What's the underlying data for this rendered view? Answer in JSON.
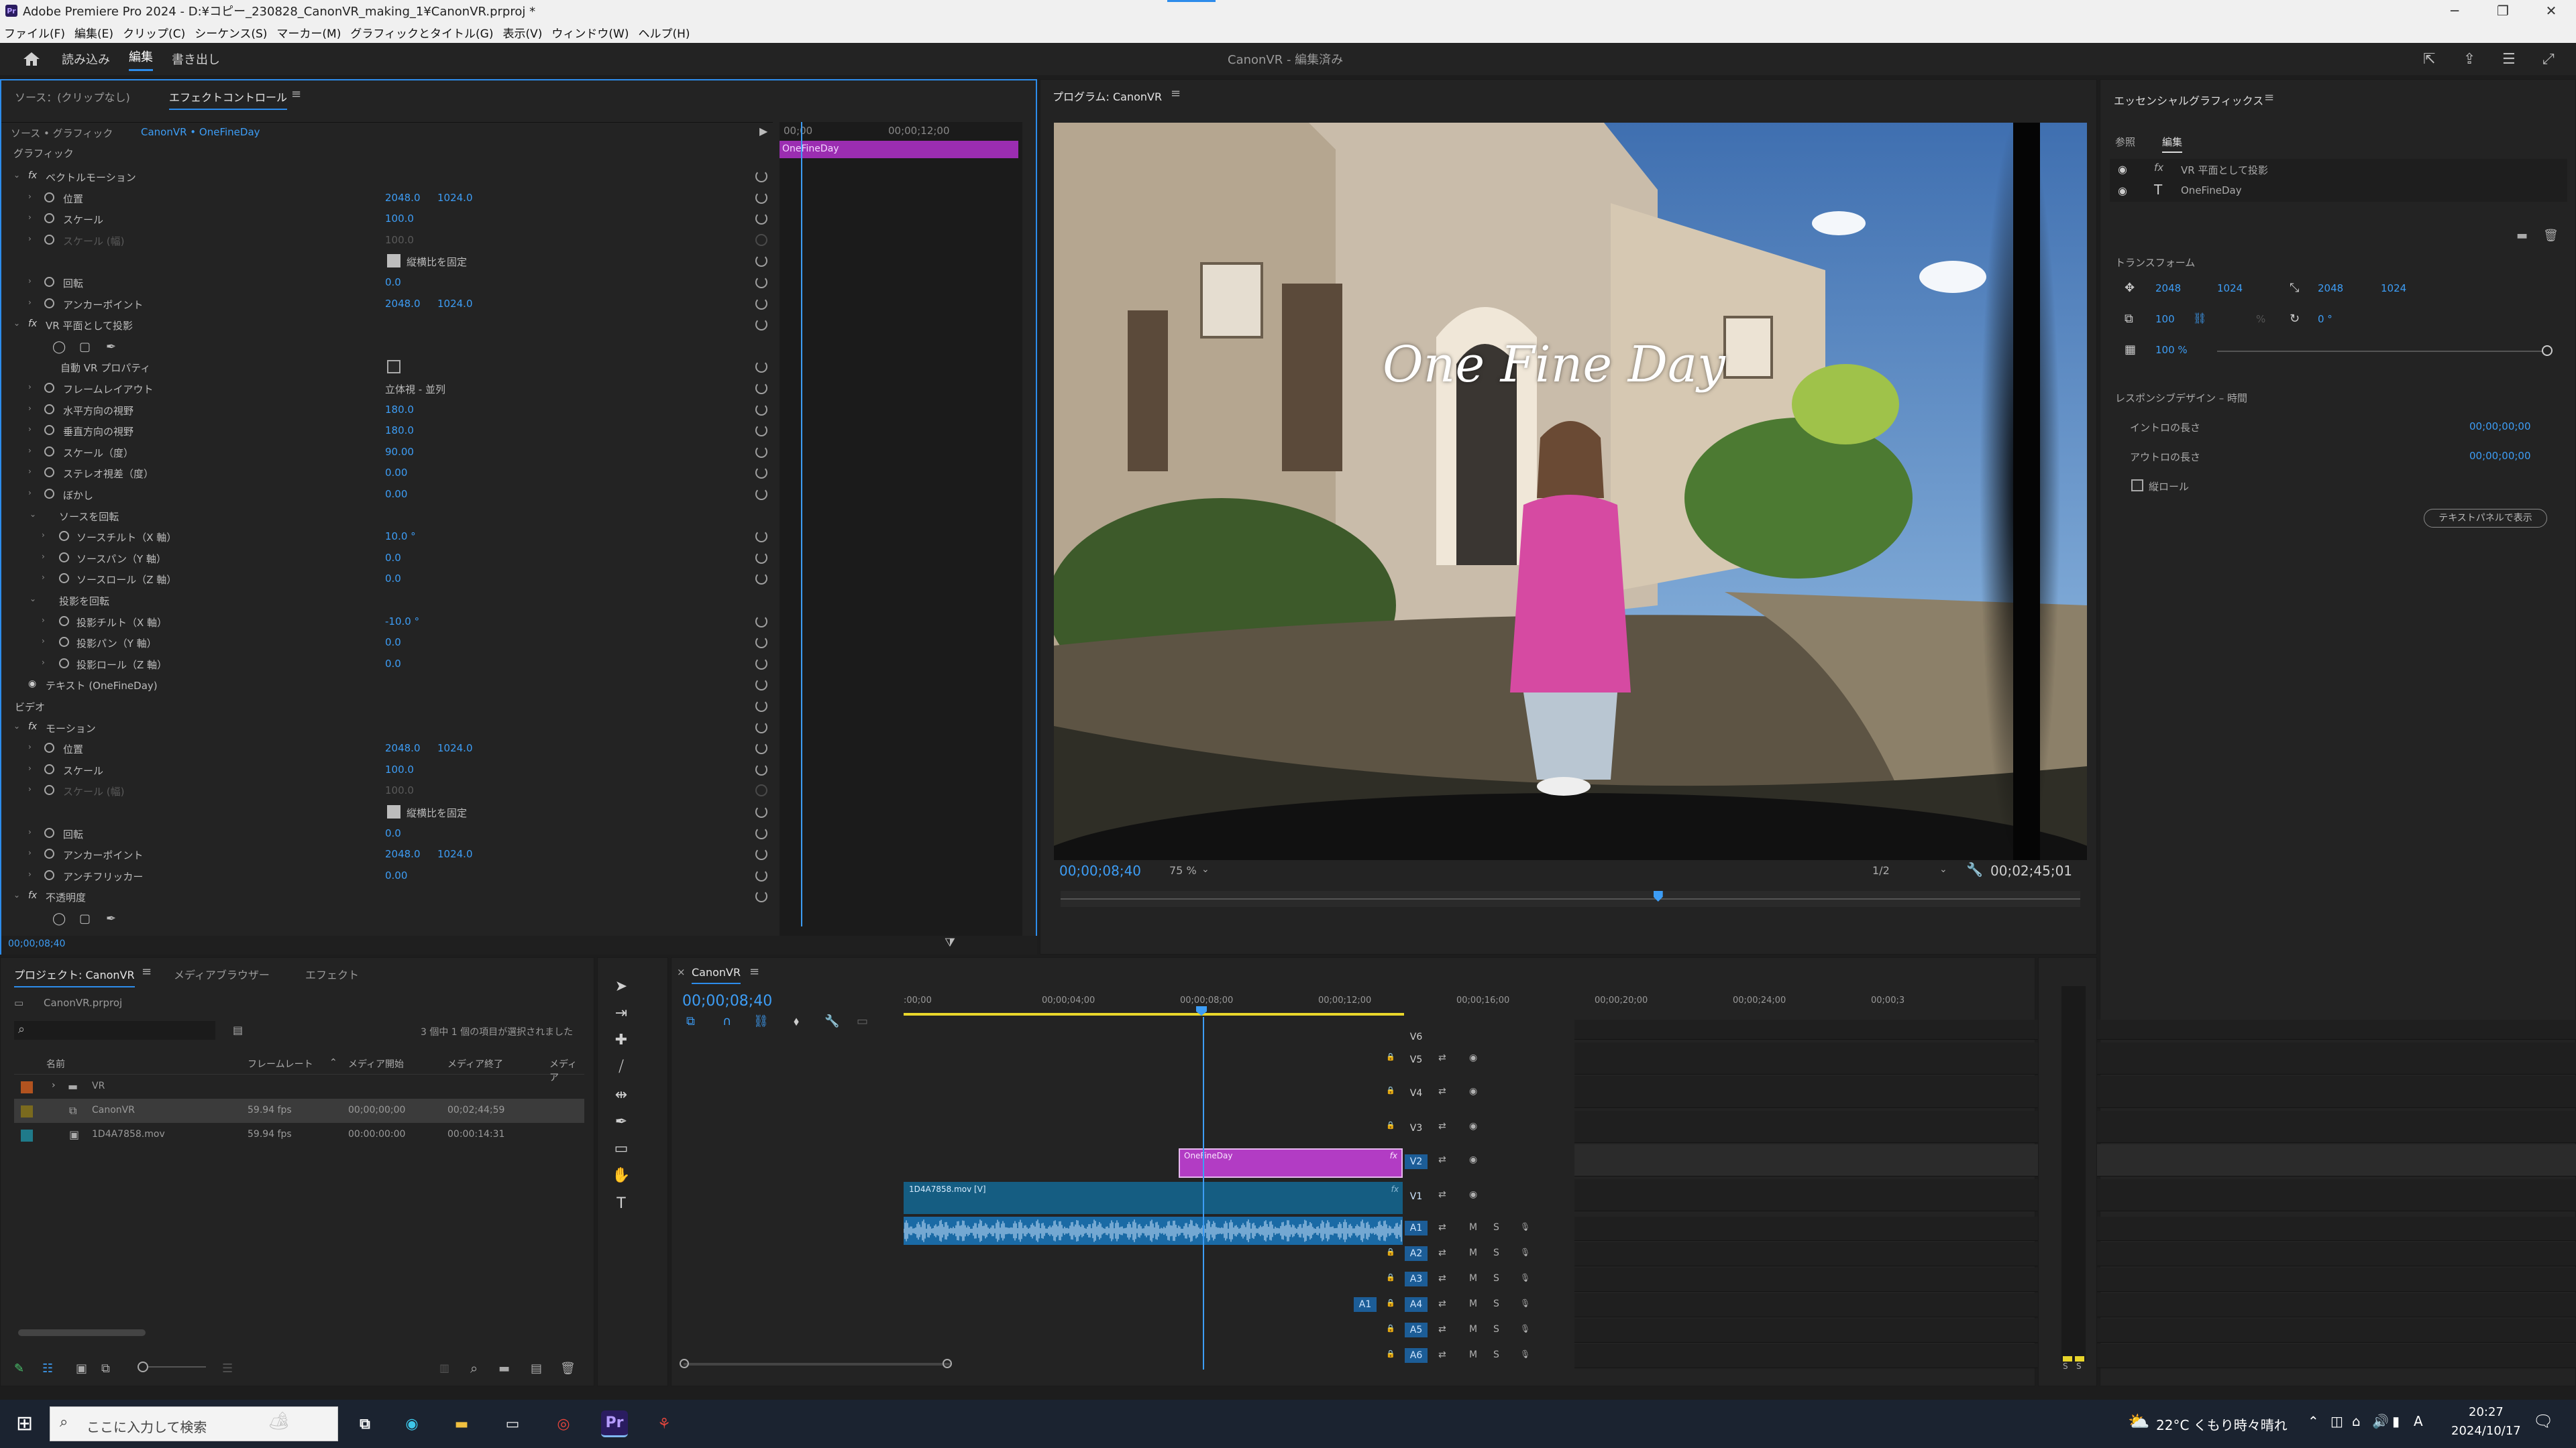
{
  "window": {
    "title": "Adobe Premiere Pro 2024 - D:¥コピー_230828_CanonVR_making_1¥CanonVR.prproj *"
  },
  "menu": [
    "ファイル(F)",
    "編集(E)",
    "クリップ(C)",
    "シーケンス(S)",
    "マーカー(M)",
    "グラフィックとタイトル(G)",
    "表示(V)",
    "ウィンドウ(W)",
    "ヘルプ(H)"
  ],
  "workspace": {
    "tabs": [
      "読み込み",
      "編集",
      "書き出し"
    ],
    "active": "編集",
    "project_status": "CanonVR - 編集済み"
  },
  "effect_controls": {
    "tabs": [
      "ソース：(クリップなし)",
      "エフェクトコントロール"
    ],
    "source_label": "ソース • グラフィック",
    "clip_label": "CanonVR • OneFineDay",
    "timecode_start": "00;00",
    "timecode_mark": "00;00;12;00",
    "clip_bar": "OneFineDay",
    "current_time": "00;00;08;40",
    "section_graphic": "グラフィック",
    "section_video": "ビデオ",
    "rows": [
      {
        "label": "ベクトルモーション",
        "fx": true
      },
      {
        "label": "位置",
        "v1": "2048.0",
        "v2": "1024.0"
      },
      {
        "label": "スケール",
        "v1": "100.0"
      },
      {
        "label": "スケール (幅)",
        "v1": "100.0",
        "dim": true
      },
      {
        "label": "縦横比を固定",
        "check": true
      },
      {
        "label": "回転",
        "v1": "0.0"
      },
      {
        "label": "アンカーポイント",
        "v1": "2048.0",
        "v2": "1024.0"
      },
      {
        "label": "VR 平面として投影",
        "fx": true
      },
      {
        "label": "",
        "masks": true
      },
      {
        "label": "自動 VR プロパティ",
        "check": false
      },
      {
        "label": "フレームレイアウト",
        "v1": "立体視 - 並列"
      },
      {
        "label": "水平方向の視野",
        "v1": "180.0"
      },
      {
        "label": "垂直方向の視野",
        "v1": "180.0"
      },
      {
        "label": "スケール（度）",
        "v1": "90.00"
      },
      {
        "label": "ステレオ視差（度）",
        "v1": "0.00"
      },
      {
        "label": "ぼかし",
        "v1": "0.00"
      },
      {
        "label": "ソースを回転"
      },
      {
        "label": "ソースチルト（X 軸）",
        "v1": "10.0 °"
      },
      {
        "label": "ソースパン（Y 軸）",
        "v1": "0.0"
      },
      {
        "label": "ソースロール（Z 軸）",
        "v1": "0.0"
      },
      {
        "label": "投影を回転"
      },
      {
        "label": "投影チルト（X 軸）",
        "v1": "-10.0 °"
      },
      {
        "label": "投影パン（Y 軸）",
        "v1": "0.0"
      },
      {
        "label": "投影ロール（Z 軸）",
        "v1": "0.0"
      },
      {
        "label": "テキスト (OneFineDay)"
      },
      {
        "label": "ビデオ"
      },
      {
        "label": "モーション",
        "fx": true
      },
      {
        "label": "位置",
        "v1": "2048.0",
        "v2": "1024.0"
      },
      {
        "label": "スケール",
        "v1": "100.0"
      },
      {
        "label": "スケール (幅)",
        "v1": "100.0",
        "dim": true
      },
      {
        "label": "縦横比を固定",
        "check": true
      },
      {
        "label": "回転",
        "v1": "0.0"
      },
      {
        "label": "アンカーポイント",
        "v1": "2048.0",
        "v2": "1024.0"
      },
      {
        "label": "アンチフリッカー",
        "v1": "0.00"
      },
      {
        "label": "不透明度",
        "fx": true
      },
      {
        "label": "",
        "masks": true
      }
    ],
    "footer_time": "00;00;08;40"
  },
  "program": {
    "title": "プログラム: CanonVR",
    "overlay_text": "One Fine Day",
    "timecode": "00;00;08;40",
    "zoom": "75 %",
    "resolution": "1/2",
    "duration": "00;02;45;01",
    "playhead_fraction": 0.586
  },
  "essential_graphics": {
    "title": "エッセンシャルグラフィックス",
    "tabs": [
      "参照",
      "編集"
    ],
    "layers": [
      "VR 平面として投影",
      "OneFineDay"
    ],
    "transform_label": "トランスフォーム",
    "pos_x": "2048",
    "pos_y": "1024",
    "anchor_x": "2048",
    "anchor_y": "1024",
    "scale": "100",
    "scale_unit": "%",
    "rotation": "0 °",
    "opacity": "100 %",
    "responsive_label": "レスポンシブデザイン – 時間",
    "intro_label": "イントロの長さ",
    "intro_val": "00;00;00;00",
    "outro_label": "アウトロの長さ",
    "outro_val": "00;00;00;00",
    "roll_label": "縦ロール",
    "text_panel_button": "テキストパネルで表示"
  },
  "project": {
    "tabs": [
      "プロジェクト: CanonVR",
      "メディアブラウザー",
      "エフェクト"
    ],
    "file": "CanonVR.prproj",
    "selection_status": "3 個中 1 個の項目が選択されました",
    "columns": [
      "名前",
      "フレームレート",
      "メディア開始",
      "メディア終了",
      "メディア"
    ],
    "items": [
      {
        "name": "VR",
        "fps": "",
        "start": "",
        "end": "",
        "color": "#b2531f",
        "folder": true
      },
      {
        "name": "CanonVR",
        "fps": "59.94 fps",
        "start": "00;00;00;00",
        "end": "00;02;44;59",
        "color": "#7a6a1e",
        "selected": true
      },
      {
        "name": "1D4A7858.mov",
        "fps": "59.94 fps",
        "start": "00:00:00:00",
        "end": "00:00:14:31",
        "color": "#1f7a8a"
      }
    ]
  },
  "timeline": {
    "tab": "CanonVR",
    "timecode": "00;00;08;40",
    "ruler": [
      ":00;00",
      "00;00;04;00",
      "00;00;08;00",
      "00;00;12;00",
      "00;00;16;00",
      "00;00;20;00",
      "00;00;24;00",
      "00;00;3"
    ],
    "video_tracks": [
      "V6",
      "V5",
      "V4",
      "V3",
      "V2",
      "V1"
    ],
    "audio_tracks": [
      "A1",
      "A2",
      "A3",
      "A4",
      "A5",
      "A6"
    ],
    "source_patch": "A1",
    "clip_graphic": "OneFineDay",
    "clip_video": "1D4A7858.mov [V]",
    "meter_labels": [
      "S",
      "S"
    ]
  },
  "taskbar": {
    "search_placeholder": "ここに入力して検索",
    "weather": "22°C くもり時々晴れ",
    "time": "20:27",
    "date": "2024/10/17",
    "ime": "A"
  },
  "colors": {
    "accent": "#2d8ceb",
    "value_blue": "#3d9df5",
    "graphic_clip": "#b23cc4",
    "video_clip": "#155d82",
    "audio_clip": "#1a6aa5"
  }
}
